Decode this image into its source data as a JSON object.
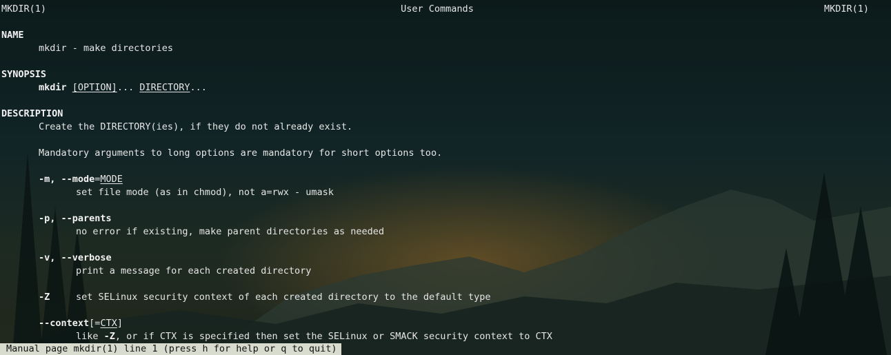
{
  "header": {
    "left": "MKDIR(1)",
    "center": "User Commands",
    "right": "MKDIR(1)"
  },
  "sections": {
    "name_heading": "NAME",
    "name_text": "mkdir - make directories",
    "synopsis_heading": "SYNOPSIS",
    "synopsis_cmd": "mkdir",
    "synopsis_option": "[OPTION]",
    "synopsis_sep": "...",
    "synopsis_directory": "DIRECTORY",
    "synopsis_tail": "...",
    "description_heading": "DESCRIPTION",
    "desc_line1": "Create the DIRECTORY(ies), if they do not already exist.",
    "desc_line2": "Mandatory arguments to long options are mandatory for short options too."
  },
  "options": {
    "mode_flag": "-m, --mode",
    "mode_eq": "=",
    "mode_arg": "MODE",
    "mode_desc": "set file mode (as in chmod), not a=rwx - umask",
    "parents_short": "-p, ",
    "parents_long": "--parents",
    "parents_desc": "no error if existing, make parent directories as needed",
    "verbose_short": "-v, ",
    "verbose_long": "--verbose",
    "verbose_desc": "print a message for each created directory",
    "z_flag": "-Z",
    "z_desc": "set SELinux security context of each created directory to the default type",
    "context_flag": "--context",
    "context_open": "[",
    "context_eq": "=",
    "context_arg": "CTX",
    "context_close": "]",
    "context_desc_a": "like ",
    "context_desc_flag": "-Z",
    "context_desc_b": ", or if CTX is specified then set the SELinux or SMACK security context to CTX"
  },
  "status_bar": "Manual page mkdir(1) line 1 (press h for help or q to quit)"
}
